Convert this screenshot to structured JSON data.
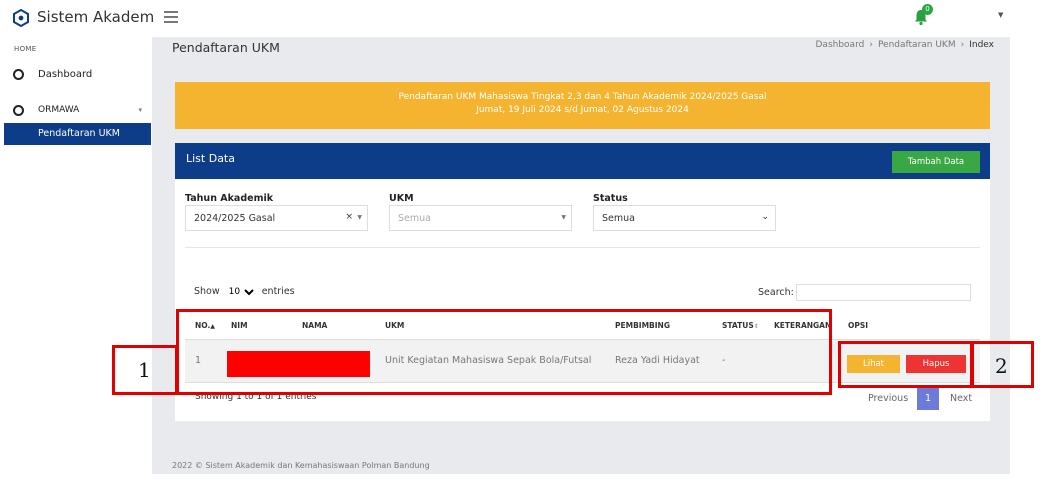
{
  "app": {
    "title": "Sistem Akademik"
  },
  "topbar": {
    "notification_count": "0"
  },
  "sidebar": {
    "header": "HOME",
    "items": [
      {
        "label": "Dashboard"
      },
      {
        "label": "ORMAWA",
        "active_child": "Pendaftaran UKM"
      }
    ]
  },
  "page": {
    "title": "Pendaftaran UKM",
    "breadcrumb": [
      "Dashboard",
      "Pendaftaran UKM",
      "Index"
    ]
  },
  "banner": {
    "line1": "Pendaftaran UKM Mahasiswa Tingkat 2,3 dan 4 Tahun Akademik 2024/2025 Gasal",
    "line2": "Jumat, 19 Juli 2024 s/d Jumat, 02 Agustus 2024"
  },
  "card": {
    "title": "List Data",
    "add_button": "Tambah Data"
  },
  "filters": {
    "tahun": {
      "label": "Tahun Akademik",
      "value": "2024/2025 Gasal"
    },
    "ukm": {
      "label": "UKM",
      "placeholder": "Semua"
    },
    "status": {
      "label": "Status",
      "value": "Semua"
    }
  },
  "table_controls": {
    "show_label": "Show",
    "entries_value": "10",
    "entries_label": "entries",
    "search_label": "Search:"
  },
  "table": {
    "columns": [
      "NO.",
      "NIM",
      "NAMA",
      "UKM",
      "PEMBIMBING",
      "STATUS",
      "KETERANGAN",
      "OPSI"
    ],
    "rows": [
      {
        "no": "1",
        "ukm": "Unit Kegiatan Mahasiswa Sepak Bola/Futsal",
        "pembimbing": "Reza Yadi Hidayat",
        "status": "-",
        "actions": {
          "view": "Lihat",
          "delete": "Hapus"
        }
      }
    ]
  },
  "pagination": {
    "info": "Showing 1 to 1 of 1 entries",
    "previous": "Previous",
    "current": "1",
    "next": "Next"
  },
  "footer": "2022 © Sistem Akademik dan Kemahasiswaan Polman Bandung",
  "annotations": {
    "box1": "1",
    "box2": "2"
  },
  "colors": {
    "navy": "#0d3c88",
    "banner": "#f5b42f",
    "success": "#3aa745",
    "danger": "#ee3333",
    "annotation": "#e00000"
  }
}
